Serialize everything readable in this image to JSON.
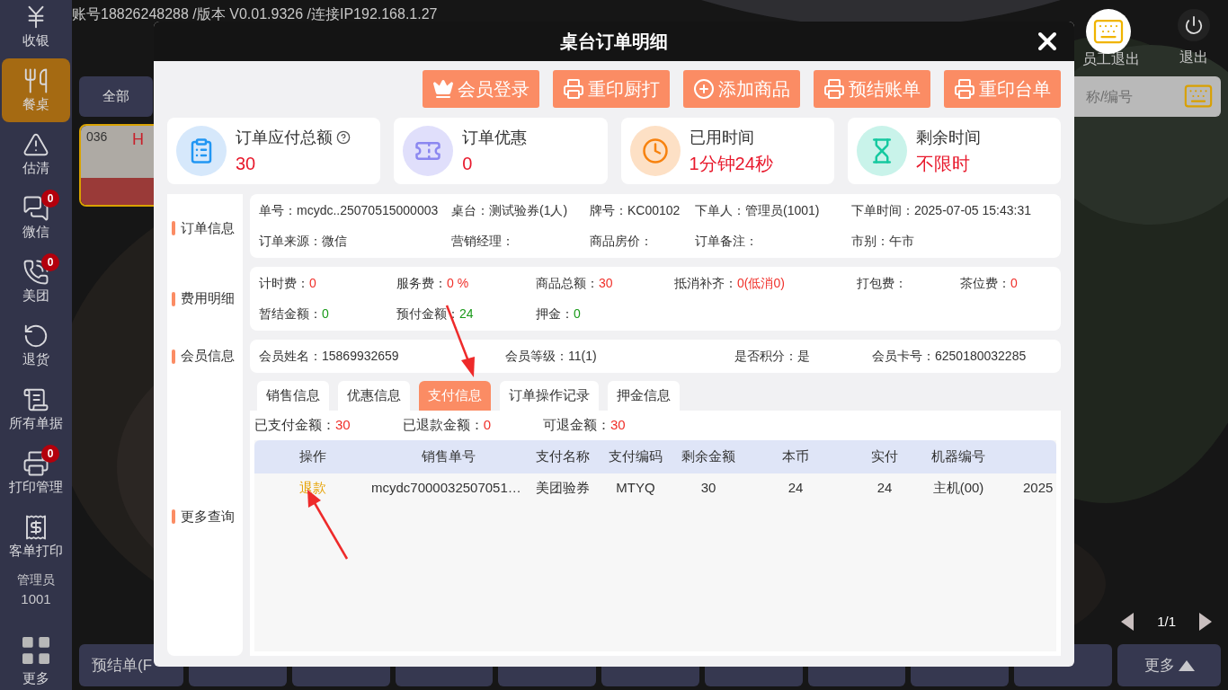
{
  "status_line": "账号18826248288 /版本 V0.01.9326 /连接IP192.168.1.27",
  "sidebar": {
    "items": [
      {
        "label": "收银",
        "selected": false
      },
      {
        "label": "餐桌",
        "selected": true
      },
      {
        "label": "估清",
        "selected": false
      },
      {
        "label": "微信",
        "badge": "0",
        "selected": false
      },
      {
        "label": "美团",
        "badge": "0",
        "selected": false
      },
      {
        "label": "退货",
        "selected": false
      },
      {
        "label": "所有单据",
        "selected": false
      },
      {
        "label": "打印管理",
        "badge": "0",
        "selected": false
      },
      {
        "label": "客单打印",
        "selected": false
      }
    ],
    "user_role": "管理员",
    "user_id": "1001",
    "more": "更多"
  },
  "top_right": {
    "staff_logout": "员工退出",
    "logout": "退出"
  },
  "area_tab": "全部",
  "search": {
    "placeholder": "称/编号"
  },
  "table_card": {
    "number": "036",
    "tag": "H"
  },
  "pagination": "1/1",
  "bottom_bar": {
    "first": "预结单(F",
    "more": "更多"
  },
  "modal": {
    "title": "桌台订单明细",
    "actions": [
      "会员登录",
      "重印厨打",
      "添加商品",
      "预结账单",
      "重印台单"
    ],
    "cards": [
      {
        "label": "订单应付总额",
        "value": "30"
      },
      {
        "label": "订单优惠",
        "value": "0"
      },
      {
        "label": "已用时间",
        "value": "1分钟24秒"
      },
      {
        "label": "剩余时间",
        "value": "不限时"
      }
    ],
    "sections": [
      {
        "label": "订单信息",
        "rows": [
          [
            {
              "label": "单号：",
              "value": "mcydc..25070515000003"
            },
            {
              "label": "桌台：",
              "value": "测试验券(1人)"
            },
            {
              "label": "牌号：",
              "value": "KC00102"
            },
            {
              "label": "下单人：",
              "value": "管理员(1001)"
            },
            {
              "label": "下单时间：",
              "value": "2025-07-05 15:43:31"
            }
          ],
          [
            {
              "label": "订单来源：",
              "value": "微信"
            },
            {
              "label": "营销经理："
            },
            {
              "label": "商品房价："
            },
            {
              "label": "订单备注："
            },
            {
              "label": "市别：",
              "value": "午市"
            }
          ]
        ]
      },
      {
        "label": "费用明细",
        "rows": [
          [
            {
              "label": "计时费：",
              "value": "0",
              "color": "#f0302a"
            },
            {
              "label": "服务费：",
              "value": "0 %",
              "color": "#f0302a"
            },
            {
              "label": "商品总额：",
              "value": "30",
              "color": "#f0302a"
            },
            {
              "label": "抵消补齐：",
              "value": "0(低消0)",
              "color": "#f0302a"
            },
            {
              "label": "打包费："
            },
            {
              "label": "茶位费：",
              "value": "0",
              "color": "#f0302a"
            }
          ],
          [
            {
              "label": "暂结金额：",
              "value": "0",
              "color": "#1a9a1a"
            },
            {
              "label": "预付金额：",
              "value": "24",
              "color": "#1a9a1a"
            },
            {
              "label": "押金：",
              "value": "0",
              "color": "#1a9a1a"
            }
          ]
        ]
      },
      {
        "label": "会员信息",
        "rows": [
          [
            {
              "label": "会员姓名：",
              "value": "15869932659"
            },
            {
              "label": "会员等级：",
              "value": "11(1)"
            },
            {
              "label": "是否积分：",
              "value": "是"
            },
            {
              "label": "会员卡号：",
              "value": "6250180032285"
            }
          ]
        ]
      }
    ],
    "more_query": {
      "label": "更多查询",
      "tabs": [
        {
          "label": "销售信息",
          "selected": false
        },
        {
          "label": "优惠信息",
          "selected": false
        },
        {
          "label": "支付信息",
          "selected": true
        },
        {
          "label": "订单操作记录",
          "selected": false
        },
        {
          "label": "押金信息",
          "selected": false
        }
      ],
      "paid_summary": [
        {
          "label": "已支付金额：",
          "value": "30"
        },
        {
          "label": "已退款金额：",
          "value": "0"
        },
        {
          "label": "可退金额：",
          "value": "30"
        }
      ],
      "table": {
        "columns": [
          "操作",
          "销售单号",
          "支付名称",
          "支付编码",
          "剩余金额",
          "本币",
          "实付",
          "机器编号"
        ],
        "rows": [
          {
            "cells": [
              "退款",
              "mcydc7000032507051…",
              "美团验券",
              "MTYQ",
              "30",
              "24",
              "24",
              "主机(00)",
              "2025"
            ]
          }
        ]
      }
    }
  }
}
